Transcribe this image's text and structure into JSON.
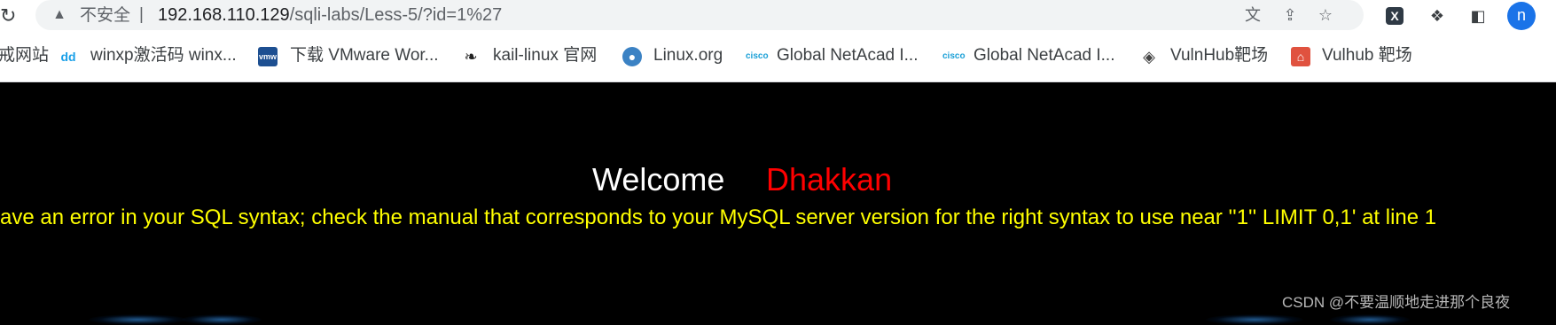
{
  "browser": {
    "security_label": "不安全",
    "separator": "|",
    "url_host": "192.168.110.129",
    "url_path": "/sqli-labs/Less-5/?id=1%27",
    "avatar_letter": "n"
  },
  "bookmarks": [
    {
      "label": "戒网站",
      "icon": "none"
    },
    {
      "label": "winxp激活码 winx...",
      "icon": "dd-icon"
    },
    {
      "label": "下载 VMware Wor...",
      "icon": "vmware-icon"
    },
    {
      "label": "kail-linux 官网",
      "icon": "kali-dragon-icon"
    },
    {
      "label": "Linux.org",
      "icon": "globe-icon"
    },
    {
      "label": "Global NetAcad I...",
      "icon": "cisco-icon"
    },
    {
      "label": "Global NetAcad I...",
      "icon": "cisco-icon"
    },
    {
      "label": "VulnHub靶场",
      "icon": "vulnhub-icon"
    },
    {
      "label": "Vulhub 靶场",
      "icon": "vulhub-icon"
    }
  ],
  "page": {
    "welcome": "Welcome",
    "name": "Dhakkan",
    "error_message": "ave an error in your SQL syntax; check the manual that corresponds to your MySQL server version for the right syntax to use near ''1'' LIMIT 0,1' at line 1",
    "watermark": "CSDN @不要温顺地走进那个良夜"
  },
  "colors": {
    "welcome": "#ffffff",
    "name": "#ff0000",
    "error": "#ffff00",
    "page_bg": "#000000",
    "avatar": "#1a73e8"
  }
}
